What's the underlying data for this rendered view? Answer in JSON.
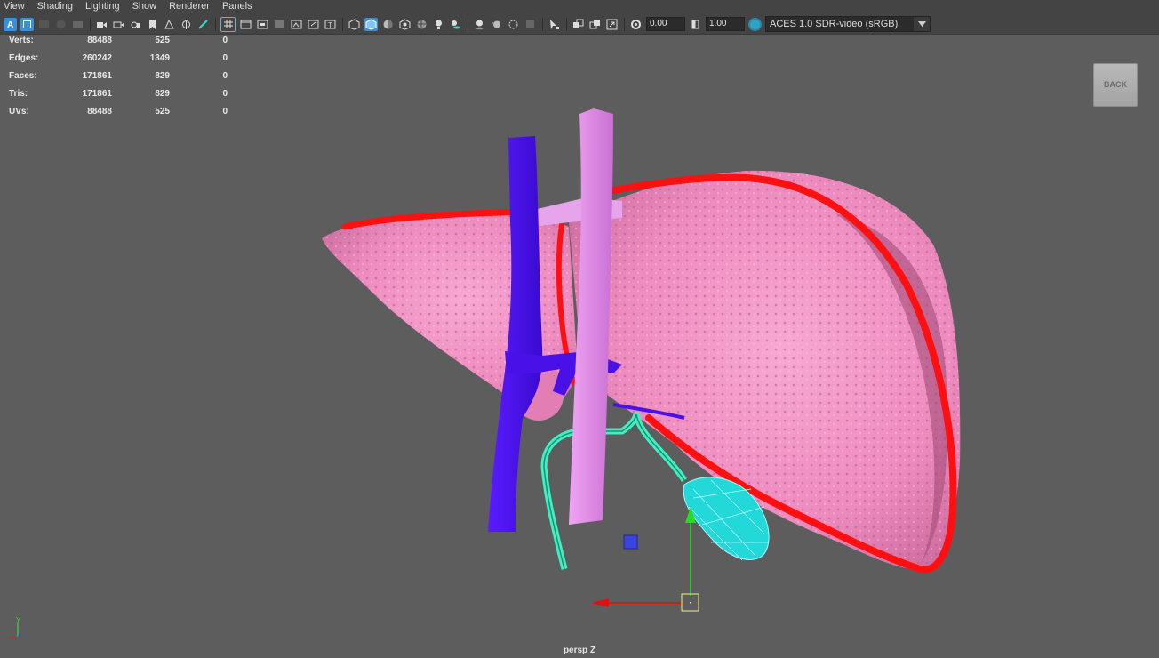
{
  "menus": [
    "View",
    "Shading",
    "Lighting",
    "Show",
    "Renderer",
    "Panels"
  ],
  "toolbar": {
    "field_a": "0.00",
    "field_b": "1.00",
    "color_space": "ACES 1.0 SDR-video (sRGB)",
    "icons": [
      "select-camera-icon",
      "camera-attributes-icon",
      "bookmark-icon",
      "image-plane-icon",
      "grease-pencil-icon",
      "2d-pan-zoom-icon",
      "grid-icon",
      "film-gate-icon",
      "resolution-gate-icon",
      "gate-mask-icon",
      "field-chart-icon",
      "safe-action-icon",
      "safe-title-icon",
      "wireframe-icon",
      "smooth-shade-icon",
      "default-material-icon",
      "textured-icon",
      "use-all-lights-icon",
      "shadows-icon",
      "ambient-occlusion-icon",
      "motion-blur-icon",
      "anti-aliasing-icon",
      "isolate-select-icon",
      "xray-icon",
      "xray-active-icon",
      "xray-joints-icon",
      "exposure-icon",
      "gamma-icon",
      "color-management-icon"
    ]
  },
  "hud": [
    {
      "label": "Verts:",
      "v1": "88488",
      "v2": "525",
      "v3": "0"
    },
    {
      "label": "Edges:",
      "v1": "260242",
      "v2": "1349",
      "v3": "0"
    },
    {
      "label": "Faces:",
      "v1": "171861",
      "v2": "829",
      "v3": "0"
    },
    {
      "label": "Tris:",
      "v1": "171861",
      "v2": "829",
      "v3": "0"
    },
    {
      "label": "UVs:",
      "v1": "88488",
      "v2": "525",
      "v3": "0"
    }
  ],
  "back_button": "BACK",
  "camera_label": "persp Z",
  "axis_label": "Y",
  "colors": {
    "liver": "#f08fc0",
    "liver_outline": "#ff1010",
    "vein": "#4a10e8",
    "aorta": "#e08ae6",
    "gallbladder": "#22d8d8",
    "bile_duct": "#3ff0c0",
    "manip_x": "#e01010",
    "manip_y": "#20e020"
  }
}
